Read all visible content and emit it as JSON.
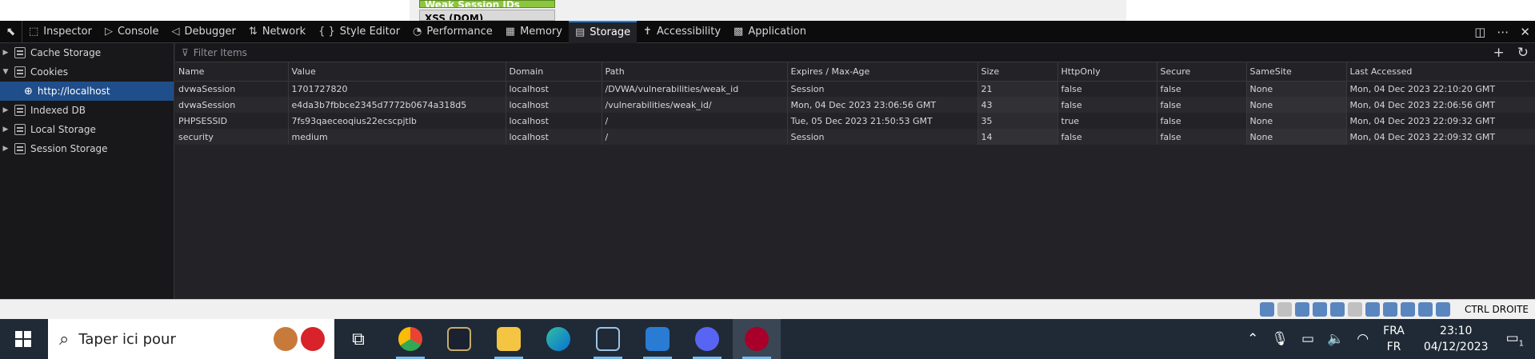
{
  "page": {
    "green_item": "Weak Session IDs",
    "gray_item": "XSS (DOM)"
  },
  "toolbar": {
    "tabs": [
      {
        "label": "Inspector",
        "icon": "inspector-icon",
        "glyph": "⬚"
      },
      {
        "label": "Console",
        "icon": "console-icon",
        "glyph": "▷"
      },
      {
        "label": "Debugger",
        "icon": "debugger-icon",
        "glyph": "◁"
      },
      {
        "label": "Network",
        "icon": "network-icon",
        "glyph": "⇅"
      },
      {
        "label": "Style Editor",
        "icon": "style-editor-icon",
        "glyph": "{ }"
      },
      {
        "label": "Performance",
        "icon": "performance-icon",
        "glyph": "◔"
      },
      {
        "label": "Memory",
        "icon": "memory-icon",
        "glyph": "▦"
      },
      {
        "label": "Storage",
        "icon": "storage-icon",
        "glyph": "▤"
      },
      {
        "label": "Accessibility",
        "icon": "accessibility-icon",
        "glyph": "✝"
      },
      {
        "label": "Application",
        "icon": "application-icon",
        "glyph": "▩"
      }
    ],
    "active_tab": "Storage"
  },
  "sidebar": {
    "items": [
      {
        "label": "Cache Storage",
        "expanded": false
      },
      {
        "label": "Cookies",
        "expanded": true
      },
      {
        "label": "http://localhost",
        "child": true,
        "selected": true
      },
      {
        "label": "Indexed DB",
        "expanded": false
      },
      {
        "label": "Local Storage",
        "expanded": false
      },
      {
        "label": "Session Storage",
        "expanded": false
      }
    ]
  },
  "filter": {
    "placeholder": "Filter Items"
  },
  "table": {
    "columns": [
      "Name",
      "Value",
      "Domain",
      "Path",
      "Expires / Max-Age",
      "Size",
      "HttpOnly",
      "Secure",
      "SameSite",
      "Last Accessed"
    ],
    "rows": [
      [
        "dvwaSession",
        "1701727820",
        "localhost",
        "/DVWA/vulnerabilities/weak_id",
        "Session",
        "21",
        "false",
        "false",
        "None",
        "Mon, 04 Dec 2023 22:10:20 GMT"
      ],
      [
        "dvwaSession",
        "e4da3b7fbbce2345d7772b0674a318d5",
        "localhost",
        "/vulnerabilities/weak_id/",
        "Mon, 04 Dec 2023 23:06:56 GMT",
        "43",
        "false",
        "false",
        "None",
        "Mon, 04 Dec 2023 22:06:56 GMT"
      ],
      [
        "PHPSESSID",
        "7fs93qaeceoqius22ecscpjtlb",
        "localhost",
        "/",
        "Tue, 05 Dec 2023 21:50:53 GMT",
        "35",
        "true",
        "false",
        "None",
        "Mon, 04 Dec 2023 22:09:32 GMT"
      ],
      [
        "security",
        "medium",
        "localhost",
        "/",
        "Session",
        "14",
        "false",
        "false",
        "None",
        "Mon, 04 Dec 2023 22:09:32 GMT"
      ]
    ]
  },
  "statusbar": {
    "host_key": "CTRL DROITE"
  },
  "taskbar": {
    "search_placeholder": "Taper ici pour",
    "lang_top": "FRA",
    "lang_bottom": "FR",
    "time": "23:10",
    "date": "04/12/2023",
    "notification_count": "1"
  },
  "colors": {
    "accent": "#0a84ff",
    "selected_row": "#204e8a",
    "devtools_bg": "#232327"
  }
}
